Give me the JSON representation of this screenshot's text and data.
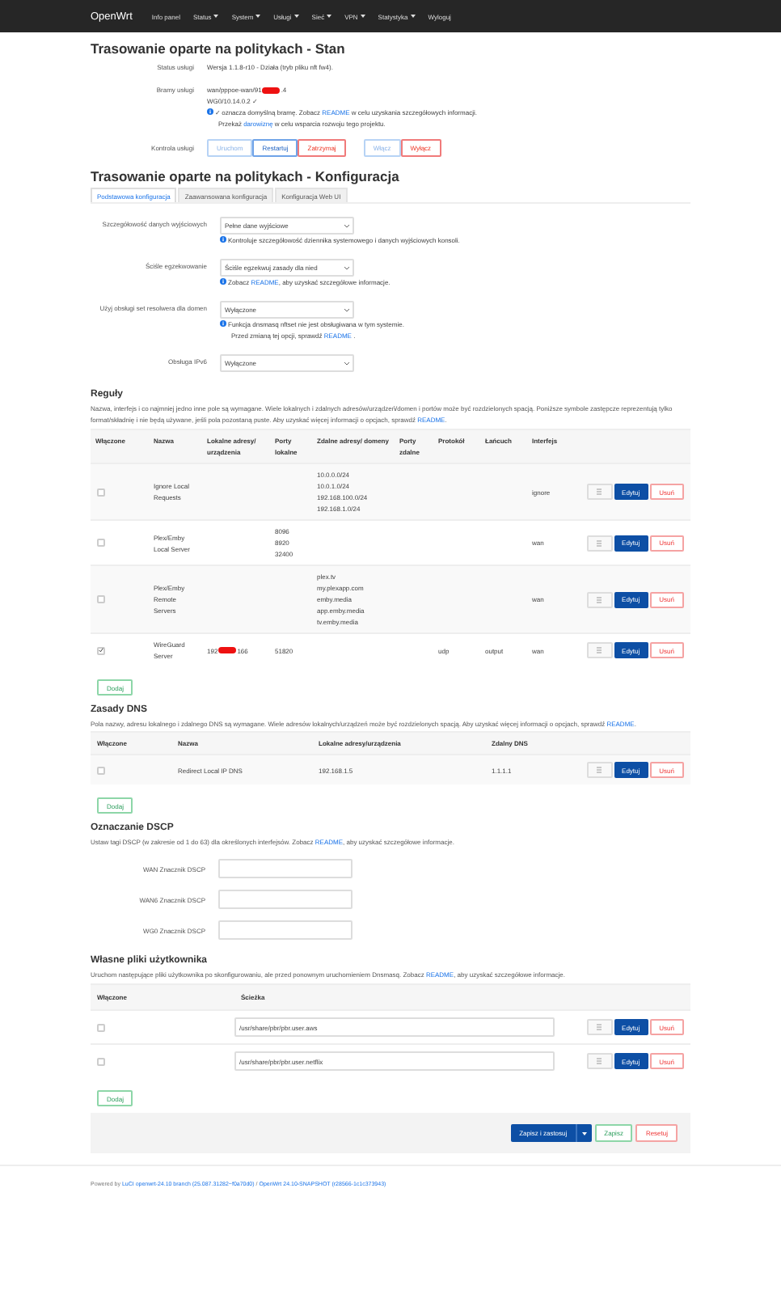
{
  "nav": {
    "brand": "OpenWrt",
    "items": [
      {
        "label": "Info panel",
        "dropdown": false
      },
      {
        "label": "Status",
        "dropdown": true
      },
      {
        "label": "System",
        "dropdown": true
      },
      {
        "label": "Usługi",
        "dropdown": true
      },
      {
        "label": "Sieć",
        "dropdown": true
      },
      {
        "label": "VPN",
        "dropdown": true
      },
      {
        "label": "Statystyka",
        "dropdown": true
      },
      {
        "label": "Wyloguj",
        "dropdown": false
      }
    ]
  },
  "status": {
    "title": "Trasowanie oparte na politykach - Stan",
    "service_label": "Status usługi",
    "service_value": "Wersja 1.1.8-r10 - Działa (tryb pliku nft fw4).",
    "gateways_label": "Bramy usługi",
    "gateways": [
      {
        "text": "wan/pppoe-wan/91",
        "redacted": true,
        "suffix": ".4"
      },
      {
        "text": "WG0/10.14.0.2 ✓",
        "redacted": false
      }
    ],
    "help": [
      [
        {
          "text": "✓ oznacza domyślną bramę. Zobacz ",
          "kind": "plain"
        },
        {
          "text": "README",
          "kind": "link"
        },
        {
          "text": " w celu uzyskania szczegółowych informacji.",
          "kind": "plain"
        }
      ],
      [
        {
          "text": "Przekaż ",
          "kind": "plain"
        },
        {
          "text": "darowiznę",
          "kind": "link"
        },
        {
          "text": " w celu wsparcia rozwoju tego projektu.",
          "kind": "plain"
        }
      ]
    ],
    "control_label": "Kontrola usługi",
    "buttons": [
      {
        "label": "Uruchom",
        "kind": "primary",
        "disabled": true
      },
      {
        "label": "Restartuj",
        "kind": "primary",
        "disabled": false
      },
      {
        "label": "Zatrzymaj",
        "kind": "negative",
        "disabled": false
      },
      {
        "label": "Włącz",
        "kind": "primary",
        "disabled": true
      },
      {
        "label": "Wyłącz",
        "kind": "negative",
        "disabled": false
      }
    ]
  },
  "config": {
    "title": "Trasowanie oparte na politykach - Konfiguracja",
    "tabs": [
      {
        "label": "Podstawowa konfiguracja",
        "selected": true
      },
      {
        "label": "Zaawansowana konfiguracja",
        "selected": false
      },
      {
        "label": "Konfiguracja Web UI",
        "selected": false
      }
    ],
    "fields": [
      {
        "label": "Szczegółowość danych wyjściowych",
        "value": "Pełne dane wyjściowe",
        "help": [
          [
            {
              "text": "Kontroluje szczegółowość dziennika systemowego i danych wyjściowych konsoli.",
              "kind": "plain"
            }
          ]
        ]
      },
      {
        "label": "Ściśle egzekwowanie",
        "value": "Ściśle egzekwuj zasady dla nied",
        "help": [
          [
            {
              "text": "Zobacz ",
              "kind": "plain"
            },
            {
              "text": "README",
              "kind": "link"
            },
            {
              "text": ", aby uzyskać szczegółowe informacje.",
              "kind": "plain"
            }
          ]
        ]
      },
      {
        "label": "Użyj obsługi set resolwera dla domen",
        "value": "Wyłączone",
        "help": [
          [
            {
              "text": "Funkcja dnsmasq nftset nie jest obsługiwana w tym systemie.",
              "kind": "plain"
            }
          ],
          [
            {
              "text": "Przed zmianą tej opcji, sprawdź ",
              "kind": "plain"
            },
            {
              "text": "README",
              "kind": "link"
            },
            {
              "text": " .",
              "kind": "plain"
            }
          ]
        ]
      },
      {
        "label": "Obsługa IPv6",
        "value": "Wyłączone"
      }
    ]
  },
  "rules": {
    "title": "Reguły",
    "description": [
      {
        "text": "Nazwa, interfejs i co najmniej jedno inne pole są wymagane. Wiele lokalnych i zdalnych adresów/urządzeń/domen i portów może być rozdzielonych spacją. Poniższe symbole zastępcze reprezentują tylko format/składnię i nie będą używane, jeśli pola pozostaną puste. Aby uzyskać więcej informacji o opcjach, sprawdź ",
        "kind": "plain"
      },
      {
        "text": "README",
        "kind": "link"
      },
      {
        "text": ".",
        "kind": "plain"
      }
    ],
    "columns": [
      "Włączone",
      "Nazwa",
      "Lokalne adresy/ urządzenia",
      "Porty lokalne",
      "Zdalne adresy/ domeny",
      "Porty zdalne",
      "Protokół",
      "Łańcuch",
      "Interfejs"
    ],
    "rows": [
      {
        "checked": false,
        "name": "Ignore Local Requests",
        "local_ports": [],
        "remote": [
          "10.0.0.0/24",
          "10.0.1.0/24",
          "192.168.100.0/24",
          "192.168.1.0/24"
        ],
        "interface": "ignore",
        "edit": "Edytuj",
        "delete": "Usuń"
      },
      {
        "checked": false,
        "name": "Plex/Emby Local Server",
        "local_ports": [
          "8096",
          "8920",
          "32400"
        ],
        "remote": [],
        "interface": "wan",
        "edit": "Edytuj",
        "delete": "Usuń"
      },
      {
        "checked": false,
        "name": "Plex/Emby Remote Servers",
        "local_ports": [],
        "remote": [
          "plex.tv",
          "my.plexapp.com",
          "emby.media",
          "app.emby.media",
          "tv.emby.media"
        ],
        "interface": "wan",
        "edit": "Edytuj",
        "delete": "Usuń"
      },
      {
        "checked": true,
        "name": "WireGuard Server",
        "local_addresses": {
          "text": "192",
          "redacted": true,
          "suffix": "166"
        },
        "local_ports": [
          "51820"
        ],
        "remote": [],
        "protocol": "udp",
        "chain": "output",
        "interface": "wan",
        "edit": "Edytuj",
        "delete": "Usuń"
      }
    ],
    "add": "Dodaj"
  },
  "dns": {
    "title": "Zasady DNS",
    "description": [
      {
        "text": "Pola nazwy, adresu lokalnego i zdalnego DNS są wymagane. Wiele adresów lokalnych/urządzeń może być rozdzielonych spacją. Aby uzyskać więcej informacji o opcjach, sprawdź ",
        "kind": "plain"
      },
      {
        "text": "README",
        "kind": "link"
      },
      {
        "text": ".",
        "kind": "plain"
      }
    ],
    "columns": [
      "Włączone",
      "Nazwa",
      "Lokalne adresy/urządzenia",
      "Zdalny DNS"
    ],
    "rows": [
      {
        "checked": false,
        "name": "Redirect Local IP DNS",
        "local": "192.168.1.5",
        "remote_dns": "1.1.1.1",
        "edit": "Edytuj",
        "delete": "Usuń"
      }
    ],
    "add": "Dodaj"
  },
  "dscp": {
    "title": "Oznaczanie DSCP",
    "description": [
      {
        "text": "Ustaw tagi DSCP (w zakresie od 1 do 63) dla określonych interfejsów. Zobacz ",
        "kind": "plain"
      },
      {
        "text": "README",
        "kind": "link"
      },
      {
        "text": ", aby uzyskać szczegółowe informacje.",
        "kind": "plain"
      }
    ],
    "fields": [
      {
        "label": "WAN Znacznik DSCP"
      },
      {
        "label": "WAN6 Znacznik DSCP"
      },
      {
        "label": "WG0 Znacznik DSCP"
      }
    ]
  },
  "user_files": {
    "title": "Własne pliki użytkownika",
    "description": [
      {
        "text": "Uruchom następujące pliki użytkownika po skonfigurowaniu, ale przed ponownym uruchomieniem Dnsmasq. Zobacz ",
        "kind": "plain"
      },
      {
        "text": "README",
        "kind": "link"
      },
      {
        "text": ", aby uzyskać szczegółowe informacje.",
        "kind": "plain"
      }
    ],
    "columns": [
      "Włączone",
      "Ścieżka"
    ],
    "rows": [
      {
        "checked": false,
        "path": "/usr/share/pbr/pbr.user.aws",
        "edit": "Edytuj",
        "delete": "Usuń"
      },
      {
        "checked": false,
        "path": "/usr/share/pbr/pbr.user.netflix",
        "edit": "Edytuj",
        "delete": "Usuń"
      }
    ],
    "add": "Dodaj"
  },
  "actions": {
    "save_apply": "Zapisz i zastosuj",
    "save": "Zapisz",
    "reset": "Resetuj"
  },
  "footer": [
    {
      "text": "Powered by ",
      "kind": "plain"
    },
    {
      "text": "LuCI openwrt-24.10 branch (25.087.31282~f0a70d0)",
      "kind": "link"
    },
    {
      "text": " / ",
      "kind": "plain"
    },
    {
      "text": "OpenWrt 24.10-SNAPSHOT (r28566-1c1c373943)",
      "kind": "link"
    }
  ]
}
